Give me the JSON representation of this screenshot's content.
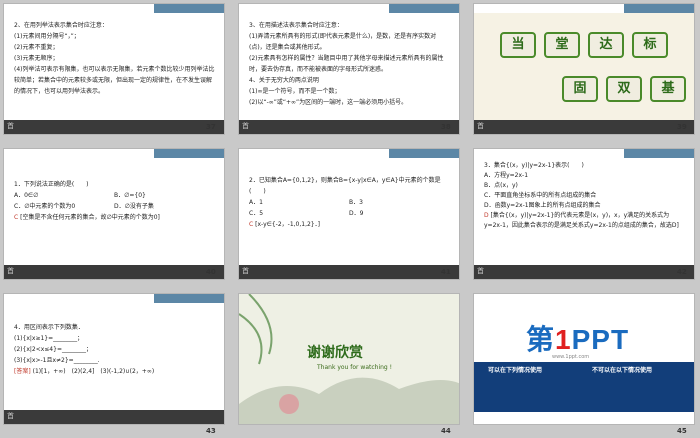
{
  "slides": [
    {
      "num": "37",
      "lines": [
        "2、在用列举法表示集合时应注意：",
        "(1)元素间用分隔号“，”；",
        "(2)元素不重复；",
        "(3)元素无顺序；",
        "(4)列举法可表示有限集，也可以表示无限集，若元素个数比较少用列举法比较简单；若集合中的元素较多或无限，但出现一定的规律性，在不发生误解的情况下，也可以用列举法表示。"
      ]
    },
    {
      "num": "38",
      "lines": [
        "3、在用描述法表示集合时应注意：",
        "(1)弄清元素所具有的形式(即代表元素是什么)，是数，还是有序实数对(点)，还是集合或其他形式。",
        "(2)元素具有怎样的属性？当题目中用了其他字母来描述元素所具有的属性时，要去伪存真，而不能被表面的字母形式所迷惑。",
        "4、关于无穷大的两点说明",
        "(1)∞是一个符号，而不是一个数；",
        "(2)以“-∞”或“+∞”为区间的一端时，这一端必须用小括号。"
      ]
    },
    {
      "num": "39",
      "title_chars": [
        "当",
        "堂",
        "达",
        "标"
      ],
      "sub_chars": [
        "固",
        "双",
        "基"
      ]
    },
    {
      "num": "40",
      "lines": [
        "1．下列说法正确的是(　　)",
        "A．0∈∅",
        "B．∅={0}",
        "C．∅中元素的个数为0",
        "D．∅没有子集"
      ],
      "answer_letter": "C",
      "answer": "[空集是不含任何元素的集合，故∅中元素的个数为0]"
    },
    {
      "num": "41",
      "lines": [
        "2．已知集合A={0,1,2}，则集合B={x-y|x∈A，y∈A}中元素的个数是(　　)",
        "A．1",
        "B．3",
        "C．5",
        "D．9"
      ],
      "answer_letter": "C",
      "answer": "[x-y∈{-2，-1,0,1,2}．]"
    },
    {
      "num": "42",
      "lines": [
        "3．集合{(x，y)|y=2x-1}表示(　　)",
        "A．方程y=2x-1",
        "B．点(x，y)",
        "C．平面直角坐标系中的所有点组成的集合",
        "D．函数y=2x-1图象上的所有点组成的集合"
      ],
      "answer_letter": "D",
      "answer": "[集合{(x，y)|y=2x-1}的代表元素是(x，y)，x，y满足的关系式为y=2x-1，因此集合表示的是满足关系式y=2x-1的点组成的集合，故选D]"
    },
    {
      "num": "43",
      "lines": [
        "4．用区间表示下列数集．",
        "(1){x|x≥1}=________；",
        "(2){x|2<x≤4}=________；",
        "(3){x|x>-1且x≠2}=________."
      ],
      "answer_tag": "[答案]",
      "answer": "(1)[1，+∞)　(2)(2,4]　(3)(-1,2)∪(2，+∞)"
    },
    {
      "num": "44",
      "thanks_cn": "谢谢欣赏",
      "thanks_en": "Thank you for watching !"
    },
    {
      "num": "45",
      "logo_a": "第",
      "logo_b": "1",
      "logo_c": "PPT",
      "site": "www.1ppt.com",
      "left_head": "可以在下列情况使用",
      "right_head": "不可以在以下情况使用"
    }
  ],
  "bottom_label": "首",
  "colors": {
    "accent": "#5c87a6",
    "answer": "#c0392b",
    "green": "#2d6b1a"
  }
}
